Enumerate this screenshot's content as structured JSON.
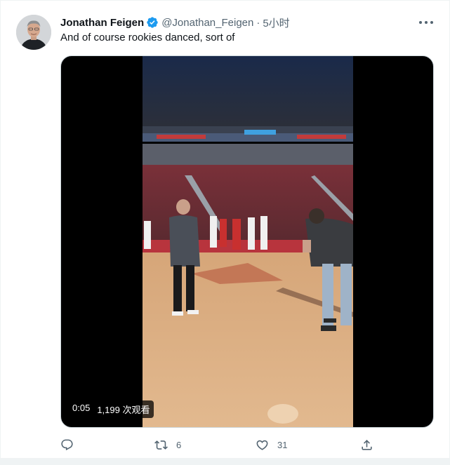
{
  "tweet": {
    "author_name": "Jonathan Feigen",
    "handle": "@Jonathan_Feigen",
    "separator": "·",
    "time": "5小时",
    "text": "And of course rookies danced, sort of"
  },
  "icons": {
    "verified": "verified-badge-icon",
    "more": "more-options-icon",
    "reply": "reply-icon",
    "retweet": "retweet-icon",
    "like": "like-icon",
    "share": "share-icon"
  },
  "video": {
    "elapsed": "0:05",
    "views": "1,199 次观看"
  },
  "stats": {
    "retweets": "6",
    "likes": "31"
  },
  "colors": {
    "verified": "#1d9bf0",
    "muted": "#536471",
    "border": "#cfd9de"
  }
}
